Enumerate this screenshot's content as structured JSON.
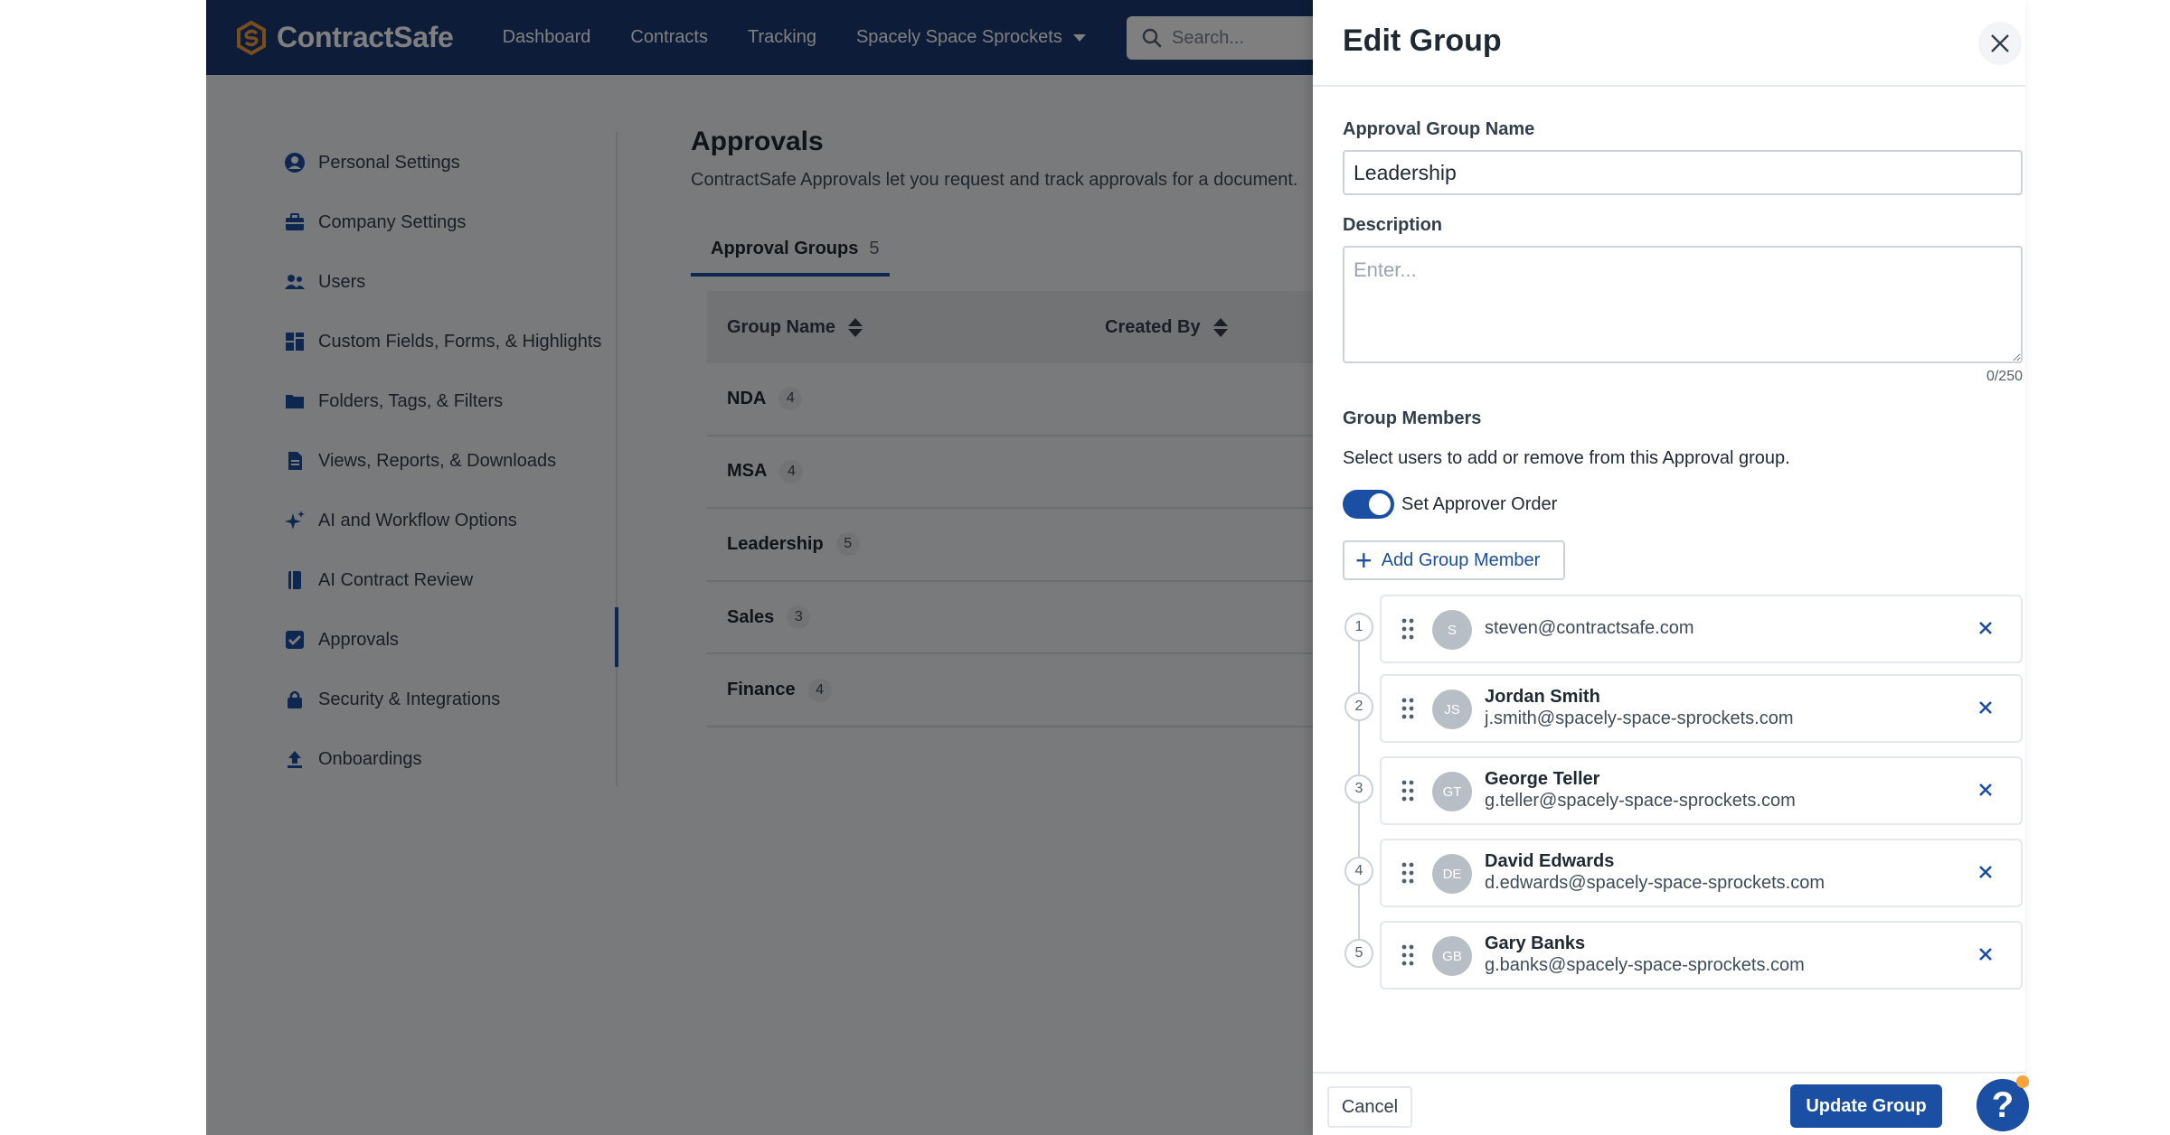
{
  "app": {
    "name": "ContractSafe"
  },
  "topnav": {
    "items": [
      "Dashboard",
      "Contracts",
      "Tracking"
    ],
    "company": "Spacely Space Sprockets",
    "search_placeholder": "Search..."
  },
  "sidebar": {
    "items": [
      {
        "label": "Personal Settings",
        "icon": "user-circle-icon"
      },
      {
        "label": "Company Settings",
        "icon": "briefcase-icon"
      },
      {
        "label": "Users",
        "icon": "users-icon"
      },
      {
        "label": "Custom Fields, Forms, & Highlights",
        "icon": "grid-icon"
      },
      {
        "label": "Folders, Tags, & Filters",
        "icon": "folder-icon"
      },
      {
        "label": "Views, Reports, & Downloads",
        "icon": "file-icon"
      },
      {
        "label": "AI and Workflow Options",
        "icon": "sparkle-icon"
      },
      {
        "label": "AI Contract Review",
        "icon": "book-icon"
      },
      {
        "label": "Approvals",
        "icon": "checkbox-icon"
      },
      {
        "label": "Security & Integrations",
        "icon": "lock-icon"
      },
      {
        "label": "Onboardings",
        "icon": "upload-icon"
      }
    ],
    "active": "Approvals"
  },
  "main": {
    "title": "Approvals",
    "subtitle": "ContractSafe Approvals let you request and track approvals for a document.",
    "tab": {
      "label": "Approval Groups",
      "count": "5"
    },
    "columns": [
      "Group Name",
      "Created By"
    ],
    "rows": [
      {
        "name": "NDA",
        "count": "4"
      },
      {
        "name": "MSA",
        "count": "4"
      },
      {
        "name": "Leadership",
        "count": "5"
      },
      {
        "name": "Sales",
        "count": "3"
      },
      {
        "name": "Finance",
        "count": "4"
      }
    ]
  },
  "drawer": {
    "title": "Edit Group",
    "name_label": "Approval Group Name",
    "name_value": "Leadership",
    "description_label": "Description",
    "description_placeholder": "Enter...",
    "char_count": "0/250",
    "members_label": "Group Members",
    "members_helper": "Select users to add or remove from this Approval group.",
    "toggle_label": "Set Approver Order",
    "toggle_on": true,
    "add_member_label": "Add Group Member",
    "members": [
      {
        "order": "1",
        "initials": "S",
        "name": "",
        "email": "steven@contractsafe.com"
      },
      {
        "order": "2",
        "initials": "JS",
        "name": "Jordan Smith",
        "email": "j.smith@spacely-space-sprockets.com"
      },
      {
        "order": "3",
        "initials": "GT",
        "name": "George Teller",
        "email": "g.teller@spacely-space-sprockets.com"
      },
      {
        "order": "4",
        "initials": "DE",
        "name": "David Edwards",
        "email": "d.edwards@spacely-space-sprockets.com"
      },
      {
        "order": "5",
        "initials": "GB",
        "name": "Gary Banks",
        "email": "g.banks@spacely-space-sprockets.com"
      }
    ],
    "cancel_label": "Cancel",
    "update_label": "Update Group",
    "help_label": "?"
  },
  "colors": {
    "brand_navy": "#1b3a73",
    "accent_blue": "#1b4fa3",
    "logo_orange": "#f29a3b"
  }
}
